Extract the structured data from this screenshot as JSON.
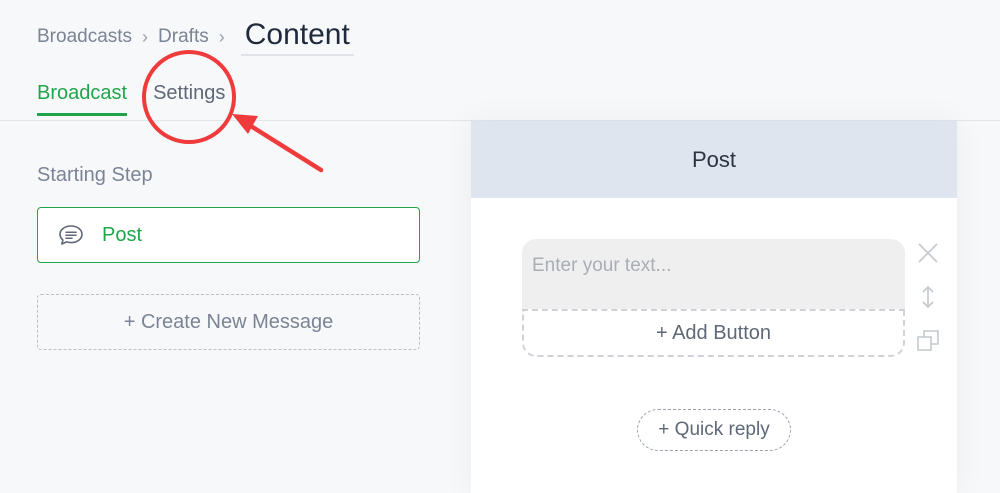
{
  "breadcrumb": {
    "items": [
      "Broadcasts",
      "Drafts"
    ],
    "current": "Content"
  },
  "tabs": [
    {
      "label": "Broadcast",
      "active": true
    },
    {
      "label": "Settings",
      "active": false
    }
  ],
  "left": {
    "section_title": "Starting Step",
    "step_label": "Post",
    "create_label": "+ Create New Message"
  },
  "panel": {
    "title": "Post",
    "text_placeholder": "Enter your text...",
    "add_button_label": "+ Add Button",
    "quick_reply_label": "+ Quick reply"
  },
  "colors": {
    "accent": "#1fa64a",
    "annotation": "#ef3b3b",
    "panel_header": "#dfe5ee"
  },
  "icons": [
    "chevron-right-icon",
    "message-icon",
    "close-icon",
    "resize-vertical-icon",
    "duplicate-icon"
  ]
}
